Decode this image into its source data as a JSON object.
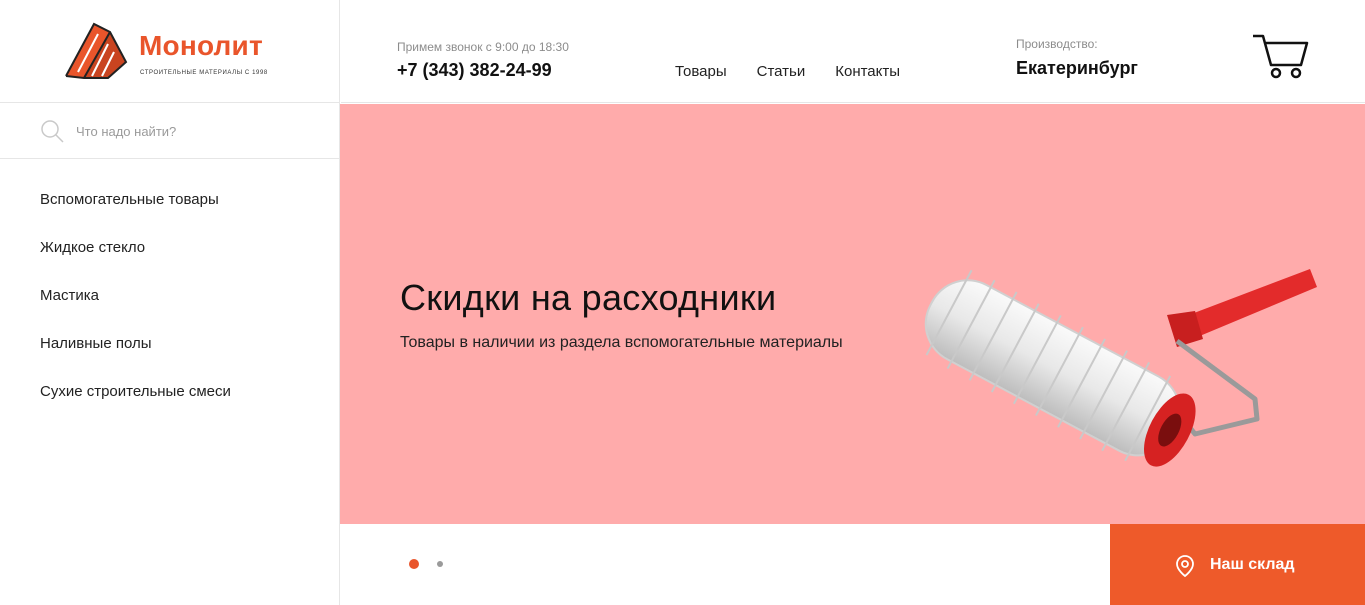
{
  "brand": {
    "name": "Монолит",
    "tagline": "СТРОИТЕЛЬНЫЕ МАТЕРИАЛЫ С 1998",
    "accent_color": "#e9552b"
  },
  "search": {
    "placeholder": "Что надо найти?",
    "value": "",
    "icon": "search-icon"
  },
  "sidebar": {
    "items": [
      {
        "label": "Вспомогательные товары"
      },
      {
        "label": "Жидкое стекло"
      },
      {
        "label": "Мастика"
      },
      {
        "label": "Наливные полы"
      },
      {
        "label": "Сухие строительные смеси"
      }
    ]
  },
  "header": {
    "call_hours": "Примем звонок с 9:00 до 18:30",
    "phone": "+7 (343) 382-24-99",
    "nav": [
      {
        "label": "Товары"
      },
      {
        "label": "Статьи"
      },
      {
        "label": "Контакты"
      }
    ],
    "production_label": "Производство:",
    "city": "Екатеринбург",
    "cart_icon": "cart-icon"
  },
  "banner": {
    "title": "Скидки на расходники",
    "subtitle": "Товары в наличии из раздела вспомогательные материалы",
    "background_color": "#ffabab",
    "image": "paint-roller-image"
  },
  "slider": {
    "slides_count": 2,
    "active_index": 0
  },
  "warehouse_button": {
    "label": "Наш склад",
    "icon": "map-pin-icon",
    "color": "#ee5a2a"
  }
}
